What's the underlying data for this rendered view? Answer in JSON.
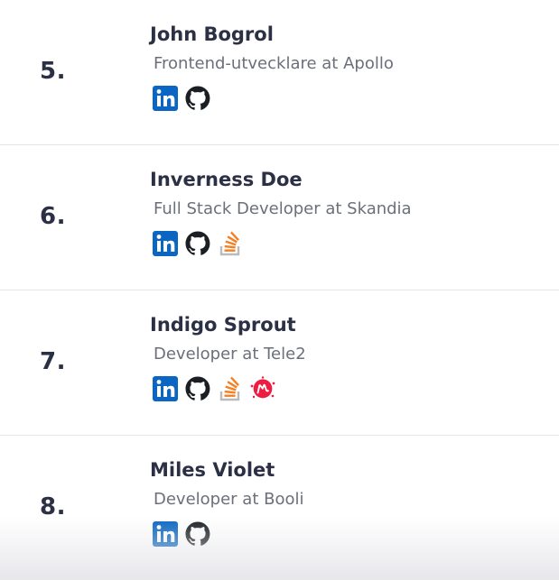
{
  "people": [
    {
      "rank": "5.",
      "name": "John Bogrol",
      "role": "Frontend-utvecklare at Apollo",
      "profiles": [
        "linkedin-icon",
        "github-icon"
      ]
    },
    {
      "rank": "6.",
      "name": "Inverness Doe",
      "role": "Full Stack Developer at Skandia",
      "profiles": [
        "linkedin-icon",
        "github-icon",
        "stackoverflow-icon"
      ]
    },
    {
      "rank": "7.",
      "name": "Indigo Sprout",
      "role": "Developer at Tele2",
      "profiles": [
        "linkedin-icon",
        "github-icon",
        "stackoverflow-icon",
        "meetup-icon"
      ]
    },
    {
      "rank": "8.",
      "name": "Miles Violet",
      "role": "Developer at Booli",
      "profiles": [
        "linkedin-icon",
        "github-icon"
      ]
    }
  ],
  "colors": {
    "linkedin": "#0a66c2",
    "github": "#1b1f23",
    "stackoverflow": "#f48024",
    "meetup": "#ed1c40",
    "text_primary": "#2b3044",
    "text_secondary": "#6b6f7a"
  }
}
